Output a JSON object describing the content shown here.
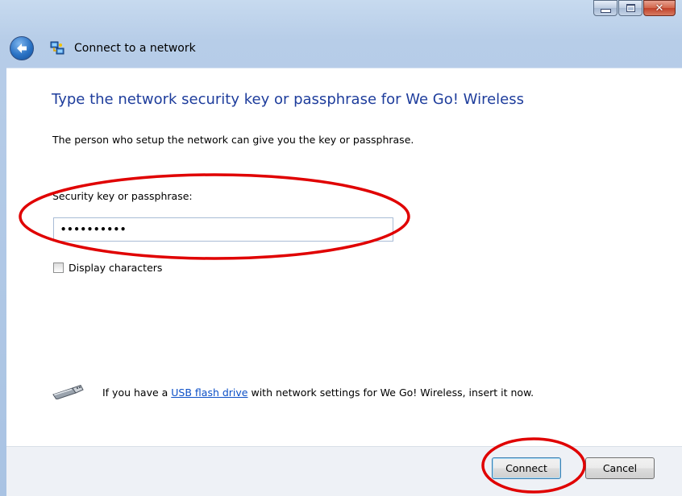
{
  "window": {
    "caption_buttons": {
      "minimize": "minimize-icon",
      "maximize": "maximize-icon",
      "close": "close-icon"
    }
  },
  "navbar": {
    "back_icon": "back-arrow-icon",
    "app_icon": "network-icon",
    "title": "Connect to a network"
  },
  "main": {
    "heading": "Type the network security key or passphrase for We Go! Wireless",
    "intro": "The person who setup the network can give you the key or passphrase.",
    "key_label": "Security key or passphrase:",
    "key_value": "••••••••••",
    "display_characters_label": "Display characters",
    "display_characters_checked": false,
    "usb": {
      "icon": "usb-drive-icon",
      "text_before": "If you have a ",
      "link_text": "USB flash drive",
      "text_after": " with network settings for We Go! Wireless, insert it now."
    }
  },
  "footer": {
    "connect_label": "Connect",
    "cancel_label": "Cancel"
  },
  "colors": {
    "heading": "#1e3d9c",
    "link": "#0b4fc7",
    "annotation": "#e00000"
  }
}
